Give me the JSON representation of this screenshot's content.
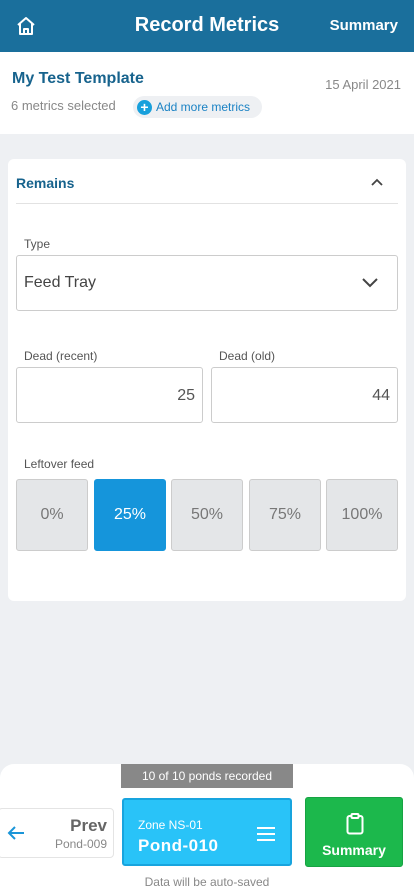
{
  "header": {
    "title": "Record Metrics",
    "summary_label": "Summary",
    "home_icon": "home-icon"
  },
  "template": {
    "name": "My Test Template",
    "date": "15 April 2021",
    "metrics_selected": "6 metrics selected",
    "add_more_label": "Add more metrics"
  },
  "section": {
    "title": "Remains",
    "type_label": "Type",
    "type_value": "Feed Tray",
    "dead_recent_label": "Dead (recent)",
    "dead_recent_value": "25",
    "dead_old_label": "Dead (old)",
    "dead_old_value": "44",
    "leftover_label": "Leftover feed",
    "leftover_options": [
      "0%",
      "25%",
      "50%",
      "75%",
      "100%"
    ],
    "leftover_selected": "25%"
  },
  "footer": {
    "ponds_recorded": "10 of 10 ponds recorded",
    "prev_label": "Prev",
    "prev_pond": "Pond-009",
    "zone": "Zone NS-01",
    "current_pond": "Pond-010",
    "summary_label": "Summary",
    "autosave": "Data will be auto-saved"
  },
  "colors": {
    "primary": "#1a6f9c",
    "accent": "#1595db",
    "success": "#1cb84c",
    "current": "#29c3f8"
  }
}
